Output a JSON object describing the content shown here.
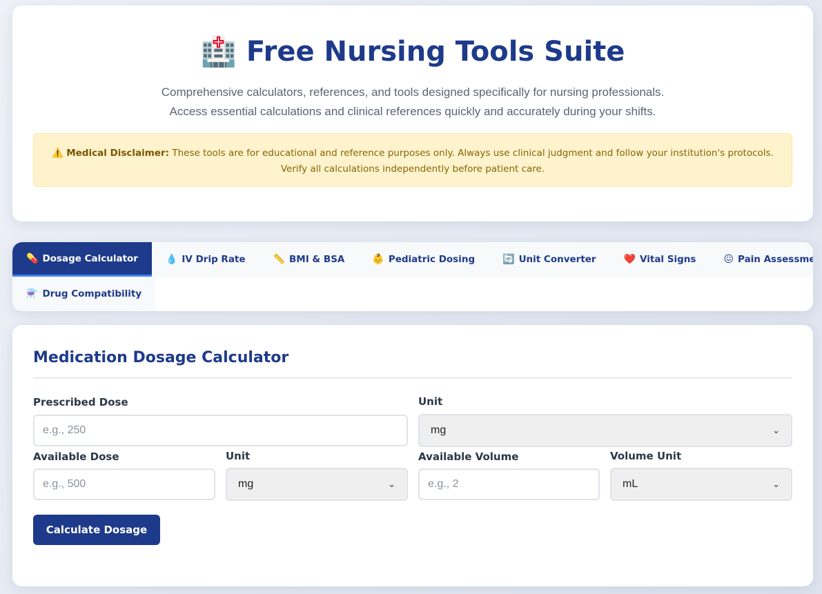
{
  "header": {
    "icon": "hospital-icon",
    "icon_glyph": "🏥",
    "title": "Free Nursing Tools Suite",
    "subtitle_line1": "Comprehensive calculators, references, and tools designed specifically for nursing professionals.",
    "subtitle_line2": "Access essential calculations and clinical references quickly and accurately during your shifts.",
    "disclaimer_icon": "⚠️",
    "disclaimer_label": "Medical Disclaimer:",
    "disclaimer_text": "These tools are for educational and reference purposes only. Always use clinical judgment and follow your institution's protocols. Verify all calculations independently before patient care."
  },
  "tabs": [
    {
      "icon": "pill-icon",
      "glyph": "💊",
      "label": "Dosage Calculator",
      "active": true
    },
    {
      "icon": "droplet-icon",
      "glyph": "💧",
      "label": "IV Drip Rate",
      "active": false
    },
    {
      "icon": "ruler-icon",
      "glyph": "📏",
      "label": "BMI & BSA",
      "active": false
    },
    {
      "icon": "baby-icon",
      "glyph": "👶",
      "label": "Pediatric Dosing",
      "active": false
    },
    {
      "icon": "refresh-icon",
      "glyph": "🔄",
      "label": "Unit Converter",
      "active": false
    },
    {
      "icon": "heart-icon",
      "glyph": "❤️",
      "label": "Vital Signs",
      "active": false
    },
    {
      "icon": "pain-face-icon",
      "glyph": "😖",
      "label": "Pain Assessment",
      "active": false
    },
    {
      "icon": "flask-icon",
      "glyph": "⚗️",
      "label": "Drug Compatibility",
      "active": false
    }
  ],
  "calculator": {
    "title": "Medication Dosage Calculator",
    "prescribed_label": "Prescribed Dose",
    "prescribed_placeholder": "e.g., 250",
    "prescribed_unit_label": "Unit",
    "prescribed_unit_value": "mg",
    "available_label": "Available Dose",
    "available_placeholder": "e.g., 500",
    "available_unit_label": "Unit",
    "available_unit_value": "mg",
    "volume_label": "Available Volume",
    "volume_placeholder": "e.g., 2",
    "volume_unit_label": "Volume Unit",
    "volume_unit_value": "mL",
    "button_label": "Calculate Dosage"
  },
  "colors": {
    "primary": "#1e3a8a",
    "active_underline": "#3b82f6",
    "disclaimer_bg": "#fff3cd",
    "disclaimer_text": "#856404"
  }
}
